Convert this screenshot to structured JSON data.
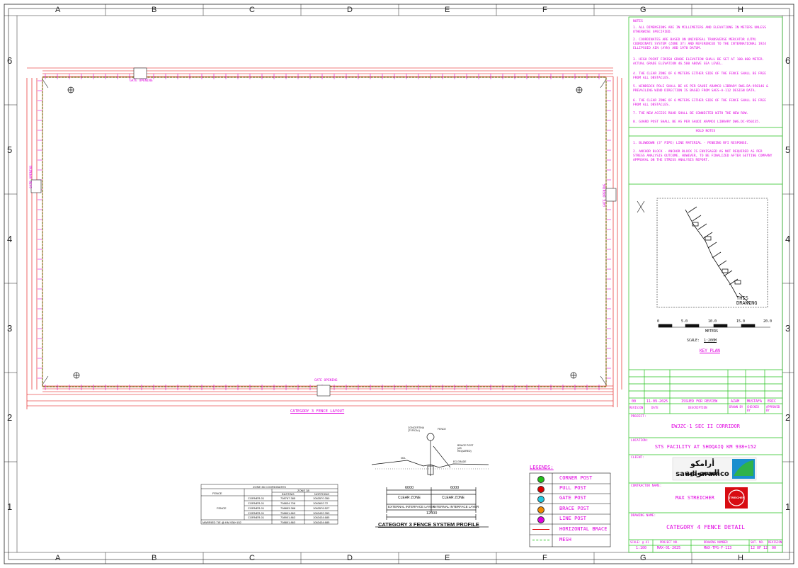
{
  "zones": {
    "letters": [
      "A",
      "B",
      "C",
      "D",
      "E",
      "F",
      "G",
      "H"
    ],
    "numbers": [
      "6",
      "5",
      "4",
      "3",
      "2",
      "1"
    ]
  },
  "layout_plan": {
    "top_gate_label": "GATE OPENING",
    "bottom_gate_label": "GATE OPENING",
    "left_gate_label": "GATE OPENING",
    "right_gate_label": "GATE OPENING",
    "caption": "CATEGORY 3 FENCE LAYOUT"
  },
  "notes": {
    "header": "NOTES",
    "items": [
      "1.  ALL DIMENSIONS ARE IN MILLIMETERS AND ELEVATIONS IN METERS UNLESS OTHERWISE SPECIFIED.",
      "2.  COORDINATES ARE BASED ON UNIVERSAL TRANSVERSE MERCATOR (UTM) COORDINATE SYSTEM (ZONE 37) AND REFERENCED TO THE INTERNATIONAL 1924 ELLIPSOID AIN (AYN) ABD 1970 DATUM.",
      "3.  HIGH POINT FINISH GRADE ELEVATION SHALL BE SET AT 100.000 METER. ACTUAL GRADE ELEVATION 46.500 ABOVE SEA LEVEL.",
      "4.  THE CLEAR ZONE OF 6 METERS EITHER SIDE OF THE FENCE SHALL BE FREE FROM ALL OBSTACLES.",
      "5.  WINDSOCK POLE SHALL BE AS PER SAUDI ARAMCO LIBRARY DWG.DA-950146 & PREVAILING WIND DIRECTION IS BASED FROM SAES-A-112 DESIGN DATA.",
      "6.  THE CLEAR ZONE OF 6 METERS EITHER SIDE OF THE FENCE SHALL BE FREE FROM ALL OBSTACLES.",
      "7.  THE NEW ACCESS ROAD SHALL BE CONNECTED WITH THE NEW ROW.",
      "8.  GUARD POST SHALL BE AS PER SAUDI ARAMCO LIBRARY DWG.DC-950235."
    ]
  },
  "hold_notes": {
    "header": "HOLD NOTES",
    "items": [
      "1.  BLOWDOWN (3” PIPE) LINE MATERIAL - PENDING RFI RESPONSE.",
      "2.  ANCHOR BLOCK - ANCHOR BLOCK IS ENVISAGED AS NOT REQUIRED AS PER STRESS ANALYSIS OUTCOME. HOWEVER, TO BE FINALIZED AFTER GETTING COMPANY APPROVAL ON THE STRESS ANALYSIS REPORT."
    ]
  },
  "key_plan": {
    "this_drawing": "THIS DRAWING",
    "scale_ticks": [
      "0",
      "5.0",
      "10.0",
      "15.0",
      "20.0"
    ],
    "scale_unit": "METERS",
    "scale_label": "SCALE:",
    "scale_value": "1:200M",
    "title": "KEY PLAN"
  },
  "revision": {
    "rev": "00",
    "date": "11-09-2025",
    "description": "ISSUED FOR REVIEW",
    "drawn": "AZAM",
    "checked": "MUSTAFA",
    "approved": "ERIC",
    "headers": [
      "REVISION",
      "DATE",
      "DESCRIPTION",
      "DRAWN BY",
      "CHECKED BY",
      "APPROVED BY"
    ]
  },
  "title_block": {
    "project_label": "PROJECT:",
    "project": "EWJZC-1 SEC II CORRIDOR",
    "location_label": "LOCATION:",
    "location": "STS FACILITY AT SHOQAIQ KM 938+152",
    "client_label": "CLIENT:",
    "client_arabic": "أرامكو السعودية",
    "client_latin": "saudi aramco",
    "contractor_label": "CONTRACTOR NAME:",
    "contractor": "MAX STREICHER",
    "contractor_logo_text": "STREICHER",
    "drawing_label": "DRAWING NAME:",
    "drawing_name": "CATEGORY 4 FENCE DETAIL",
    "footer_headers": [
      "SCALE: @ A1",
      "PROJECT NO.",
      "DRAWING NUMBER",
      "SHT. NO.",
      "REVISION"
    ],
    "scale": "1:100",
    "project_no": "MAX-01-2025",
    "drawing_no": "MAX-TPG-F-113",
    "sheet_no": "12 OF 12",
    "revision_no": "00"
  },
  "legend": {
    "title": "LEGENDS:",
    "items": [
      {
        "label": "CORNER POST",
        "symbol": "circle",
        "color": "#22c01a"
      },
      {
        "label": "PULL POST",
        "symbol": "circle",
        "color": "#e00000"
      },
      {
        "label": "GATE POST",
        "symbol": "circle",
        "color": "#22c8e0"
      },
      {
        "label": "BRACE POST",
        "symbol": "circle",
        "color": "#f08a00"
      },
      {
        "label": "LINE POST",
        "symbol": "circle",
        "color": "#e000e0"
      },
      {
        "label": "HORIZONTAL BRACE",
        "symbol": "line",
        "color": "#e00000"
      },
      {
        "label": "MESH",
        "symbol": "dashed",
        "color": "#22c01a"
      }
    ]
  },
  "profile": {
    "left_dim": "6000",
    "right_dim": "6000",
    "left_zone": "CLEAR ZONE",
    "right_zone": "CLEAR ZONE",
    "left_layer": "EXTERNAL INTERFACE LAYER",
    "right_layer": "INTERNAL INTERFACE LAYER",
    "total_dim": "12000",
    "title": "CATEGORY 3 FENCE SYSTEM PROFILE",
    "label_concertina": "CONCERTINA (TYPICAL)",
    "label_fence": "FENCE",
    "label_brace": "BRACE POST (AS REQUIRED)",
    "label_ngl": "NGL",
    "label_eg": "EG GRADE"
  },
  "coord_table": {
    "title": "ZONE 38 COORDINATES",
    "col_fence": "FENCE",
    "col_zone": "ZONE 38",
    "col_easting": "EASTING",
    "col_northing": "NORTHING",
    "group": "FENCE",
    "rows": [
      {
        "name": "CORNER-01",
        "e": "708767.385",
        "n": "1063570.350"
      },
      {
        "name": "CORNER-01",
        "e": "708834.708",
        "n": "1063602.72"
      },
      {
        "name": "CORNER-01",
        "e": "708853.388",
        "n": "1063576.527"
      },
      {
        "name": "CORNER-01",
        "e": "708801.863",
        "n": "1063432.353"
      },
      {
        "name": "CORNER-01",
        "e": "708901.863",
        "n": "1063434.685"
      }
    ],
    "footer_label": "MARRIED TIE @ KM 936+152",
    "footer_e": "708801.863",
    "footer_n": "1063434.685"
  }
}
